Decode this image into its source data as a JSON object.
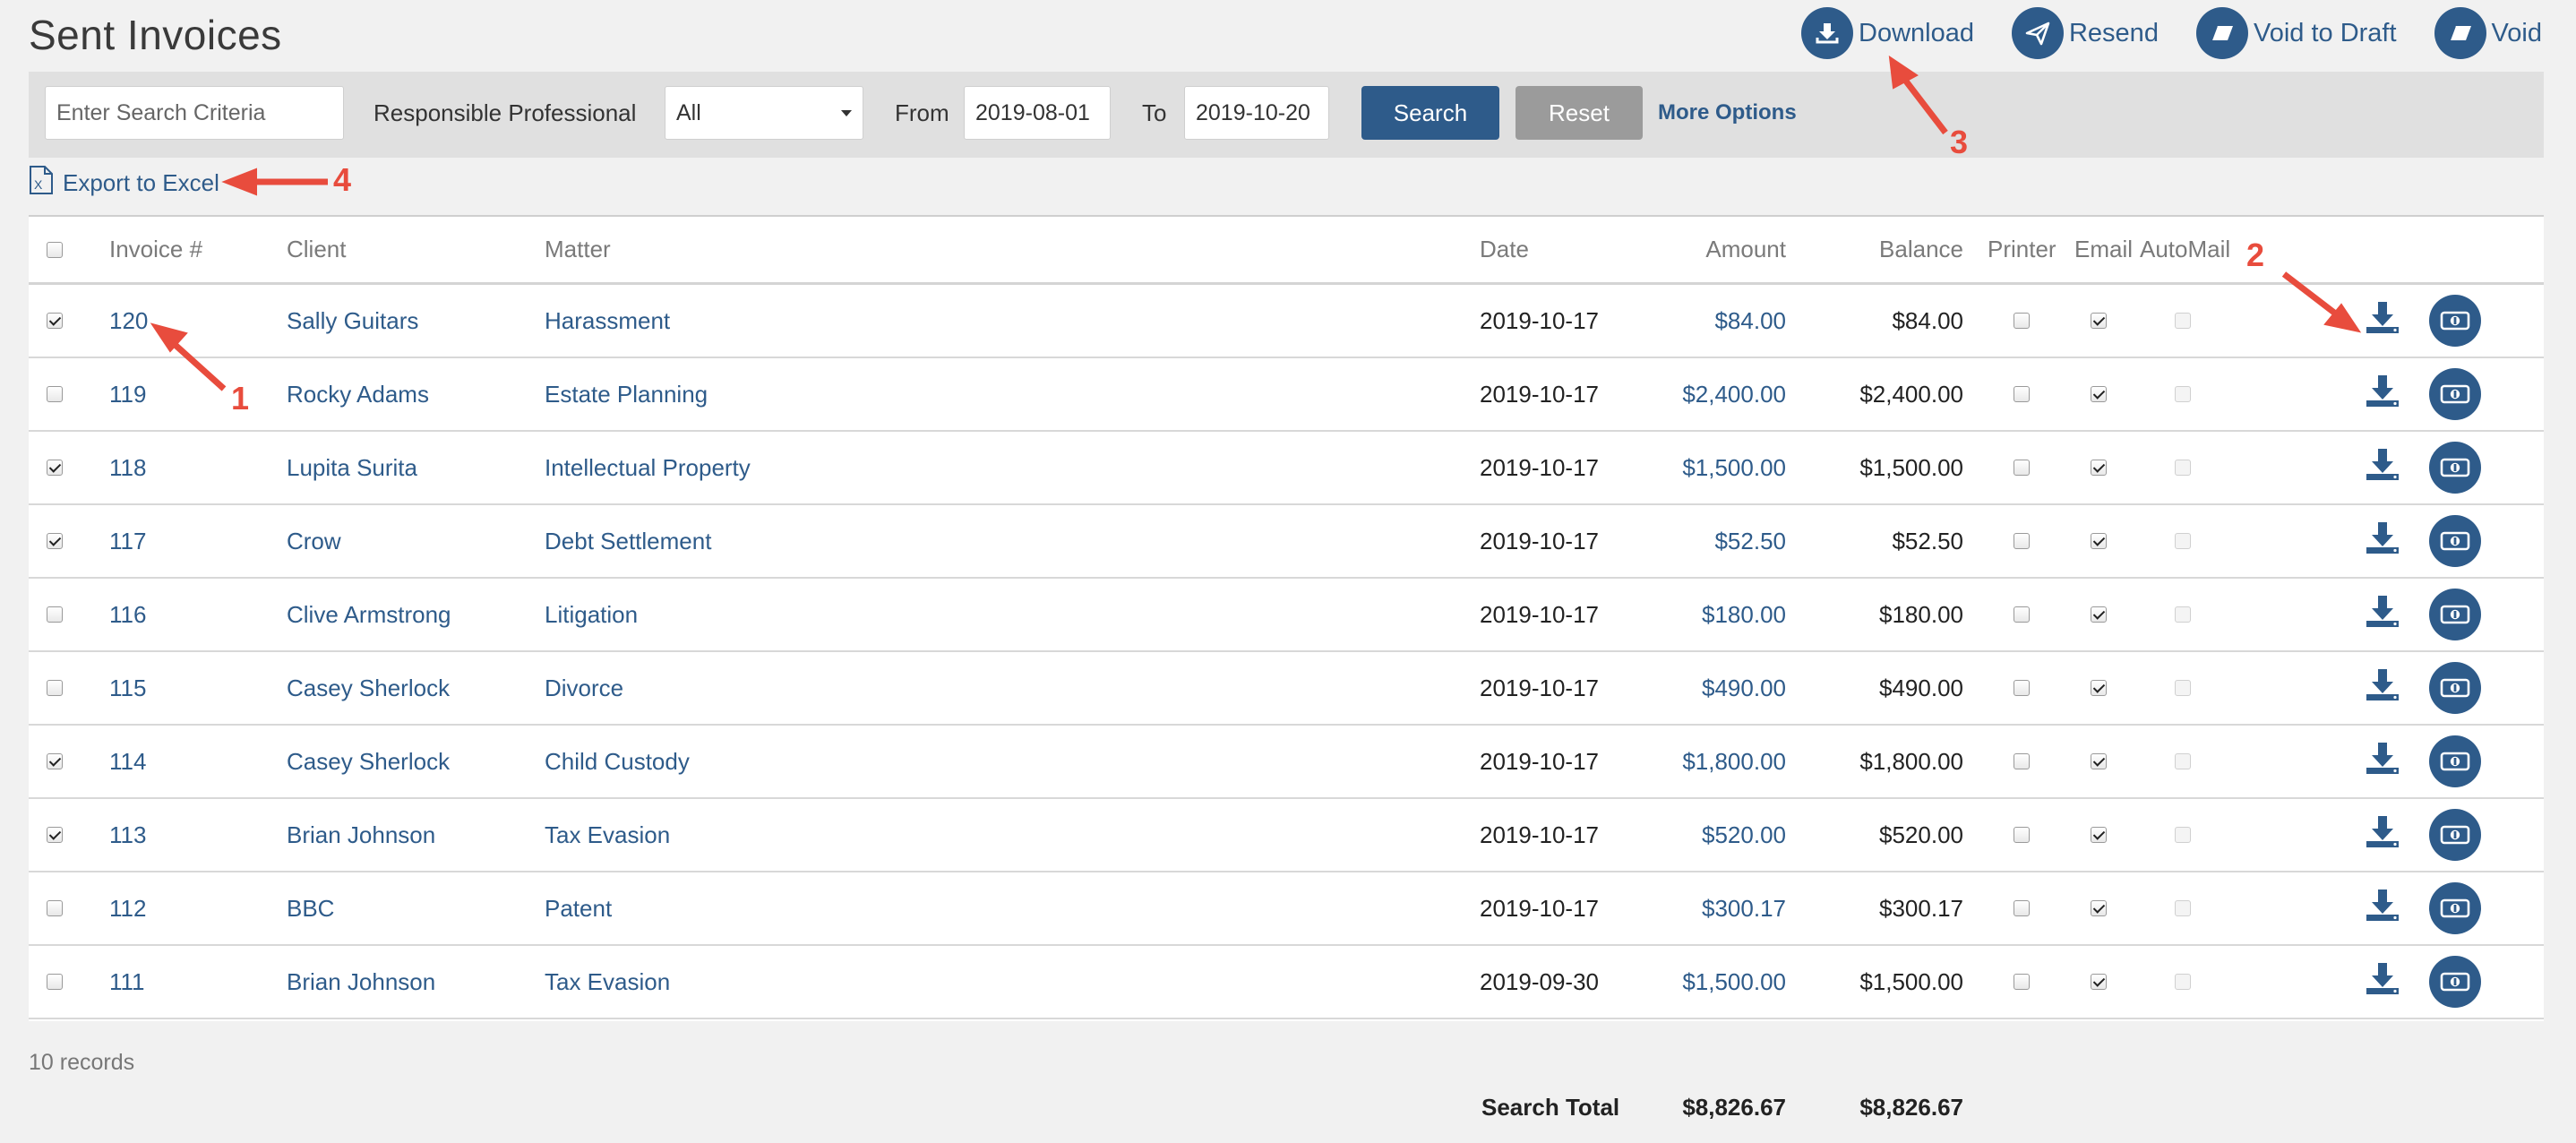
{
  "page_title": "Sent Invoices",
  "actions": [
    {
      "label": "Download",
      "icon": "download-icon"
    },
    {
      "label": "Resend",
      "icon": "paper-plane-icon"
    },
    {
      "label": "Void to Draft",
      "icon": "eraser-icon"
    },
    {
      "label": "Void",
      "icon": "eraser-icon"
    }
  ],
  "filters": {
    "search_placeholder": "Enter Search Criteria",
    "responsible_label": "Responsible Professional",
    "responsible_value": "All",
    "from_label": "From",
    "from_value": "2019-08-01",
    "to_label": "To",
    "to_value": "2019-10-20",
    "search_label": "Search",
    "reset_label": "Reset",
    "more_options_label": "More Options"
  },
  "export_label": "Export to Excel",
  "table": {
    "columns": [
      "Invoice #",
      "Client",
      "Matter",
      "Date",
      "Amount",
      "Balance",
      "Printer",
      "Email",
      "AutoMail"
    ],
    "rows": [
      {
        "selected": true,
        "invoice": "120",
        "client": "Sally Guitars",
        "matter": "Harassment",
        "date": "2019-10-17",
        "amount": "$84.00",
        "balance": "$84.00",
        "printer": false,
        "email": true,
        "automail": false
      },
      {
        "selected": false,
        "invoice": "119",
        "client": "Rocky Adams",
        "matter": "Estate Planning",
        "date": "2019-10-17",
        "amount": "$2,400.00",
        "balance": "$2,400.00",
        "printer": false,
        "email": true,
        "automail": false
      },
      {
        "selected": true,
        "invoice": "118",
        "client": "Lupita Surita",
        "matter": "Intellectual Property",
        "date": "2019-10-17",
        "amount": "$1,500.00",
        "balance": "$1,500.00",
        "printer": false,
        "email": true,
        "automail": false
      },
      {
        "selected": true,
        "invoice": "117",
        "client": "Crow",
        "matter": "Debt Settlement",
        "date": "2019-10-17",
        "amount": "$52.50",
        "balance": "$52.50",
        "printer": false,
        "email": true,
        "automail": false
      },
      {
        "selected": false,
        "invoice": "116",
        "client": "Clive Armstrong",
        "matter": "Litigation",
        "date": "2019-10-17",
        "amount": "$180.00",
        "balance": "$180.00",
        "printer": false,
        "email": true,
        "automail": false
      },
      {
        "selected": false,
        "invoice": "115",
        "client": "Casey Sherlock",
        "matter": "Divorce",
        "date": "2019-10-17",
        "amount": "$490.00",
        "balance": "$490.00",
        "printer": false,
        "email": true,
        "automail": false
      },
      {
        "selected": true,
        "invoice": "114",
        "client": "Casey Sherlock",
        "matter": "Child Custody",
        "date": "2019-10-17",
        "amount": "$1,800.00",
        "balance": "$1,800.00",
        "printer": false,
        "email": true,
        "automail": false
      },
      {
        "selected": true,
        "invoice": "113",
        "client": "Brian Johnson",
        "matter": "Tax Evasion",
        "date": "2019-10-17",
        "amount": "$520.00",
        "balance": "$520.00",
        "printer": false,
        "email": true,
        "automail": false
      },
      {
        "selected": false,
        "invoice": "112",
        "client": "BBC",
        "matter": "Patent",
        "date": "2019-10-17",
        "amount": "$300.17",
        "balance": "$300.17",
        "printer": false,
        "email": true,
        "automail": false
      },
      {
        "selected": false,
        "invoice": "111",
        "client": "Brian Johnson",
        "matter": "Tax Evasion",
        "date": "2019-09-30",
        "amount": "$1,500.00",
        "balance": "$1,500.00",
        "printer": false,
        "email": true,
        "automail": false
      }
    ]
  },
  "records_text": "10 records",
  "totals": {
    "label": "Search Total",
    "amount": "$8,826.67",
    "balance": "$8,826.67"
  },
  "annotations": [
    "1",
    "2",
    "3",
    "4"
  ],
  "colors": {
    "brand_blue": "#2e5b8a",
    "annotation_red": "#e84c3d",
    "reset_gray": "#9b9b9b"
  }
}
